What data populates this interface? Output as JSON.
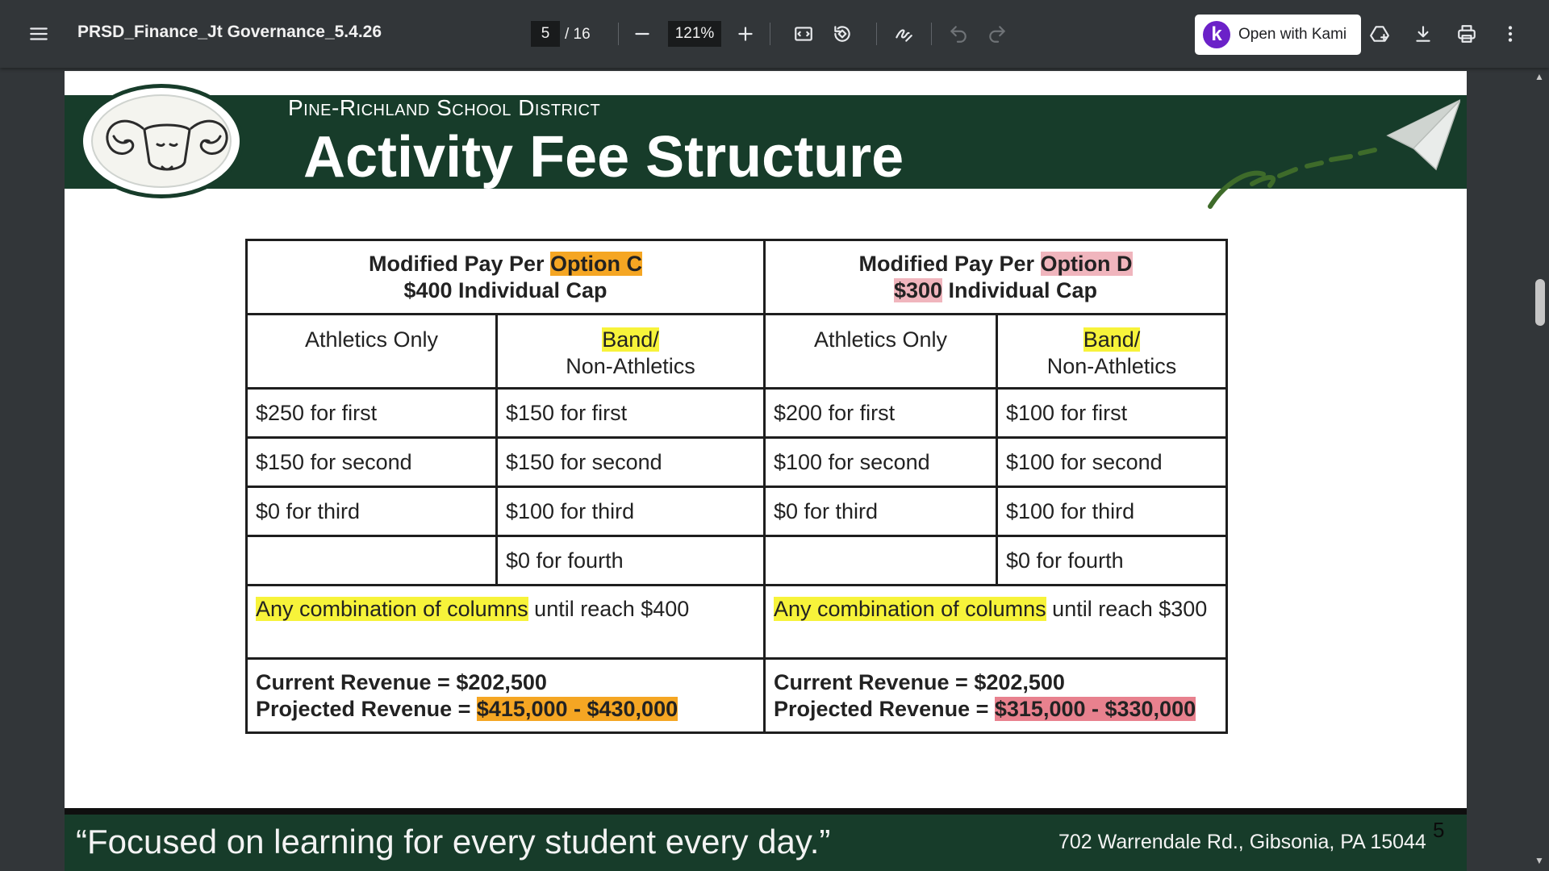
{
  "toolbar": {
    "title": "PRSD_Finance_Jt Governance_5.4.26",
    "current_page": "5",
    "total_pages": "/ 16",
    "zoom": "121%",
    "kami_label": "Open with Kami",
    "kami_logo": "k",
    "icons": [
      "menu-icon",
      "zoom-out-icon",
      "zoom-in-icon",
      "fit-page-icon",
      "rotate-icon",
      "annotate-icon",
      "undo-icon",
      "redo-icon",
      "drive-add-icon",
      "download-icon",
      "print-icon",
      "more-vert-icon"
    ]
  },
  "slide": {
    "district": "Pine-Richland School District",
    "title": "Activity Fee Structure",
    "motto": "“Focused on learning for every student every day.”",
    "address": "702 Warrendale Rd., Gibsonia, PA 15044",
    "slide_number": "5"
  },
  "table": {
    "option_c": {
      "header_prefix": "Modified Pay Per ",
      "header_highlight": "Option C",
      "cap_text": "$400 Individual Cap",
      "highlight_color": "#f5a623"
    },
    "option_d": {
      "header_prefix": "Modified Pay Per ",
      "header_highlight": "Option D",
      "cap_amount": "$300",
      "cap_rest": " Individual Cap",
      "highlight_color": "#f0b5bd"
    },
    "subheaders": {
      "athletics": "Athletics Only",
      "band": "Band/",
      "non_athletics": "Non-Athletics"
    },
    "rows": [
      [
        "$250 for first",
        "$150 for first",
        "$200 for first",
        "$100 for first"
      ],
      [
        "$150 for second",
        "$150 for second",
        "$100 for second",
        "$100 for second"
      ],
      [
        "$0 for third",
        "$100 for third",
        "$0 for third",
        "$100 for third"
      ],
      [
        "",
        "$0 for fourth",
        "",
        "$0 for fourth"
      ]
    ],
    "combo_c": {
      "highlight": "Any combination of columns",
      "rest": " until reach $400"
    },
    "combo_d": {
      "highlight": "Any combination of columns",
      "rest": " until reach $300"
    },
    "revenue_c": {
      "current": "Current Revenue = $202,500",
      "projected_label": "Projected Revenue = ",
      "projected_value": "$415,000 - $430,000"
    },
    "revenue_d": {
      "current": "Current Revenue = $202,500",
      "projected_label": "Projected Revenue = ",
      "projected_value": "$315,000 - $330,000"
    }
  }
}
